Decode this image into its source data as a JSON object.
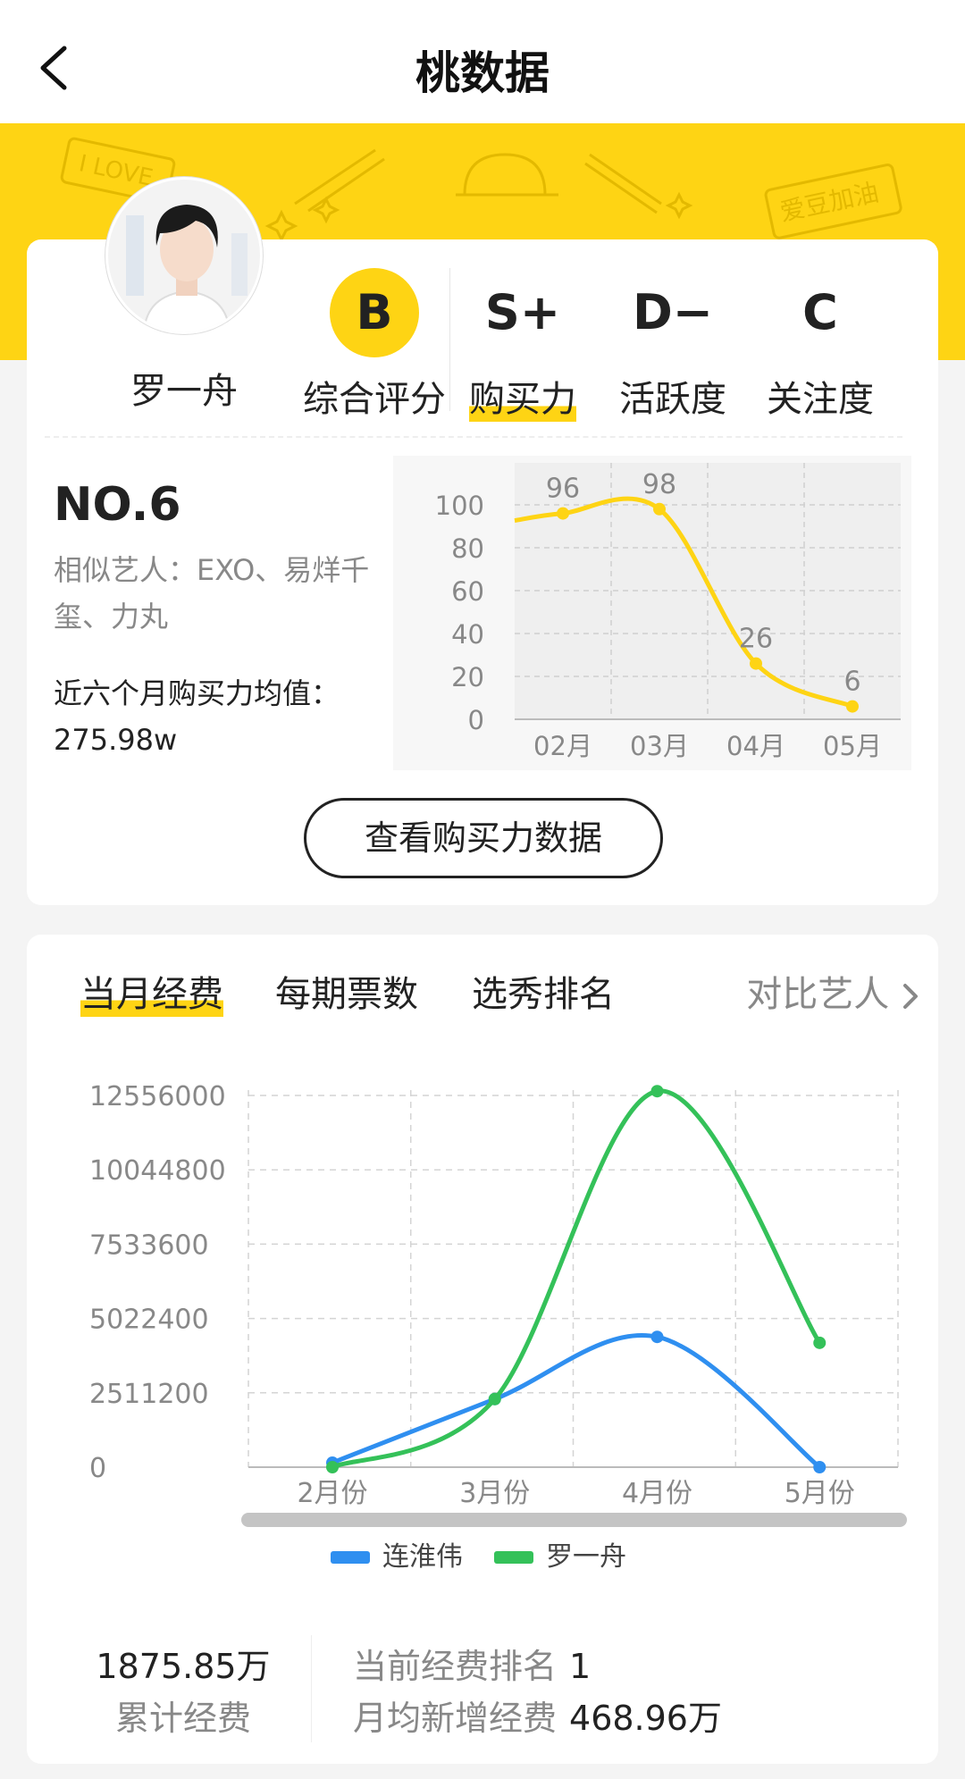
{
  "header": {
    "title": "桃数据"
  },
  "banner": {
    "deco_text_1": "I LOVE",
    "deco_text_2": "爱豆加油"
  },
  "artist": {
    "name": "罗一舟"
  },
  "grades": [
    {
      "letter": "B",
      "label": "综合评分",
      "highlight": true
    },
    {
      "letter": "S+",
      "label": "购买力",
      "underline": true
    },
    {
      "letter": "D−",
      "label": "活跃度"
    },
    {
      "letter": "C",
      "label": "关注度"
    }
  ],
  "purchase": {
    "rank": "NO.6",
    "similar": "相似艺人：EXO、易烊千玺、力丸",
    "avg_label": "近六个月购买力均值：",
    "avg_value": "275.98w",
    "button": "查看购买力数据"
  },
  "tabs": {
    "t1": "当月经费",
    "t2": "每期票数",
    "t3": "选秀排名",
    "compare": "对比艺人"
  },
  "summary": {
    "total_value": "1875.85万",
    "total_label": "累计经费",
    "rank_label": "当前经费排名",
    "rank_value": "1",
    "monthly_label": "月均新增经费",
    "monthly_value": "468.96万"
  },
  "colors": {
    "accent": "#fed414",
    "blue": "#2f8ff0",
    "green": "#34c159"
  },
  "chart_data": [
    {
      "type": "line",
      "categories": [
        "02月",
        "03月",
        "04月",
        "05月"
      ],
      "series": [
        {
          "values": [
            96,
            98,
            26,
            6
          ]
        }
      ],
      "yticks": [
        "100",
        "80",
        "60",
        "40",
        "20",
        "0"
      ],
      "ylim": [
        0,
        100
      ],
      "grid": true
    },
    {
      "type": "line",
      "categories": [
        "2月份",
        "3月份",
        "4月份",
        "5月份"
      ],
      "series": [
        {
          "name": "连淮伟",
          "values": [
            150000,
            2300000,
            4400000,
            0
          ]
        },
        {
          "name": "罗一舟",
          "values": [
            0,
            2300000,
            12700000,
            4200000
          ]
        }
      ],
      "yticks": [
        "12556000",
        "10044800",
        "7533600",
        "5022400",
        "2511200",
        "0"
      ],
      "ylim": [
        0,
        12556000
      ],
      "legend": "bottom",
      "grid": true
    }
  ]
}
